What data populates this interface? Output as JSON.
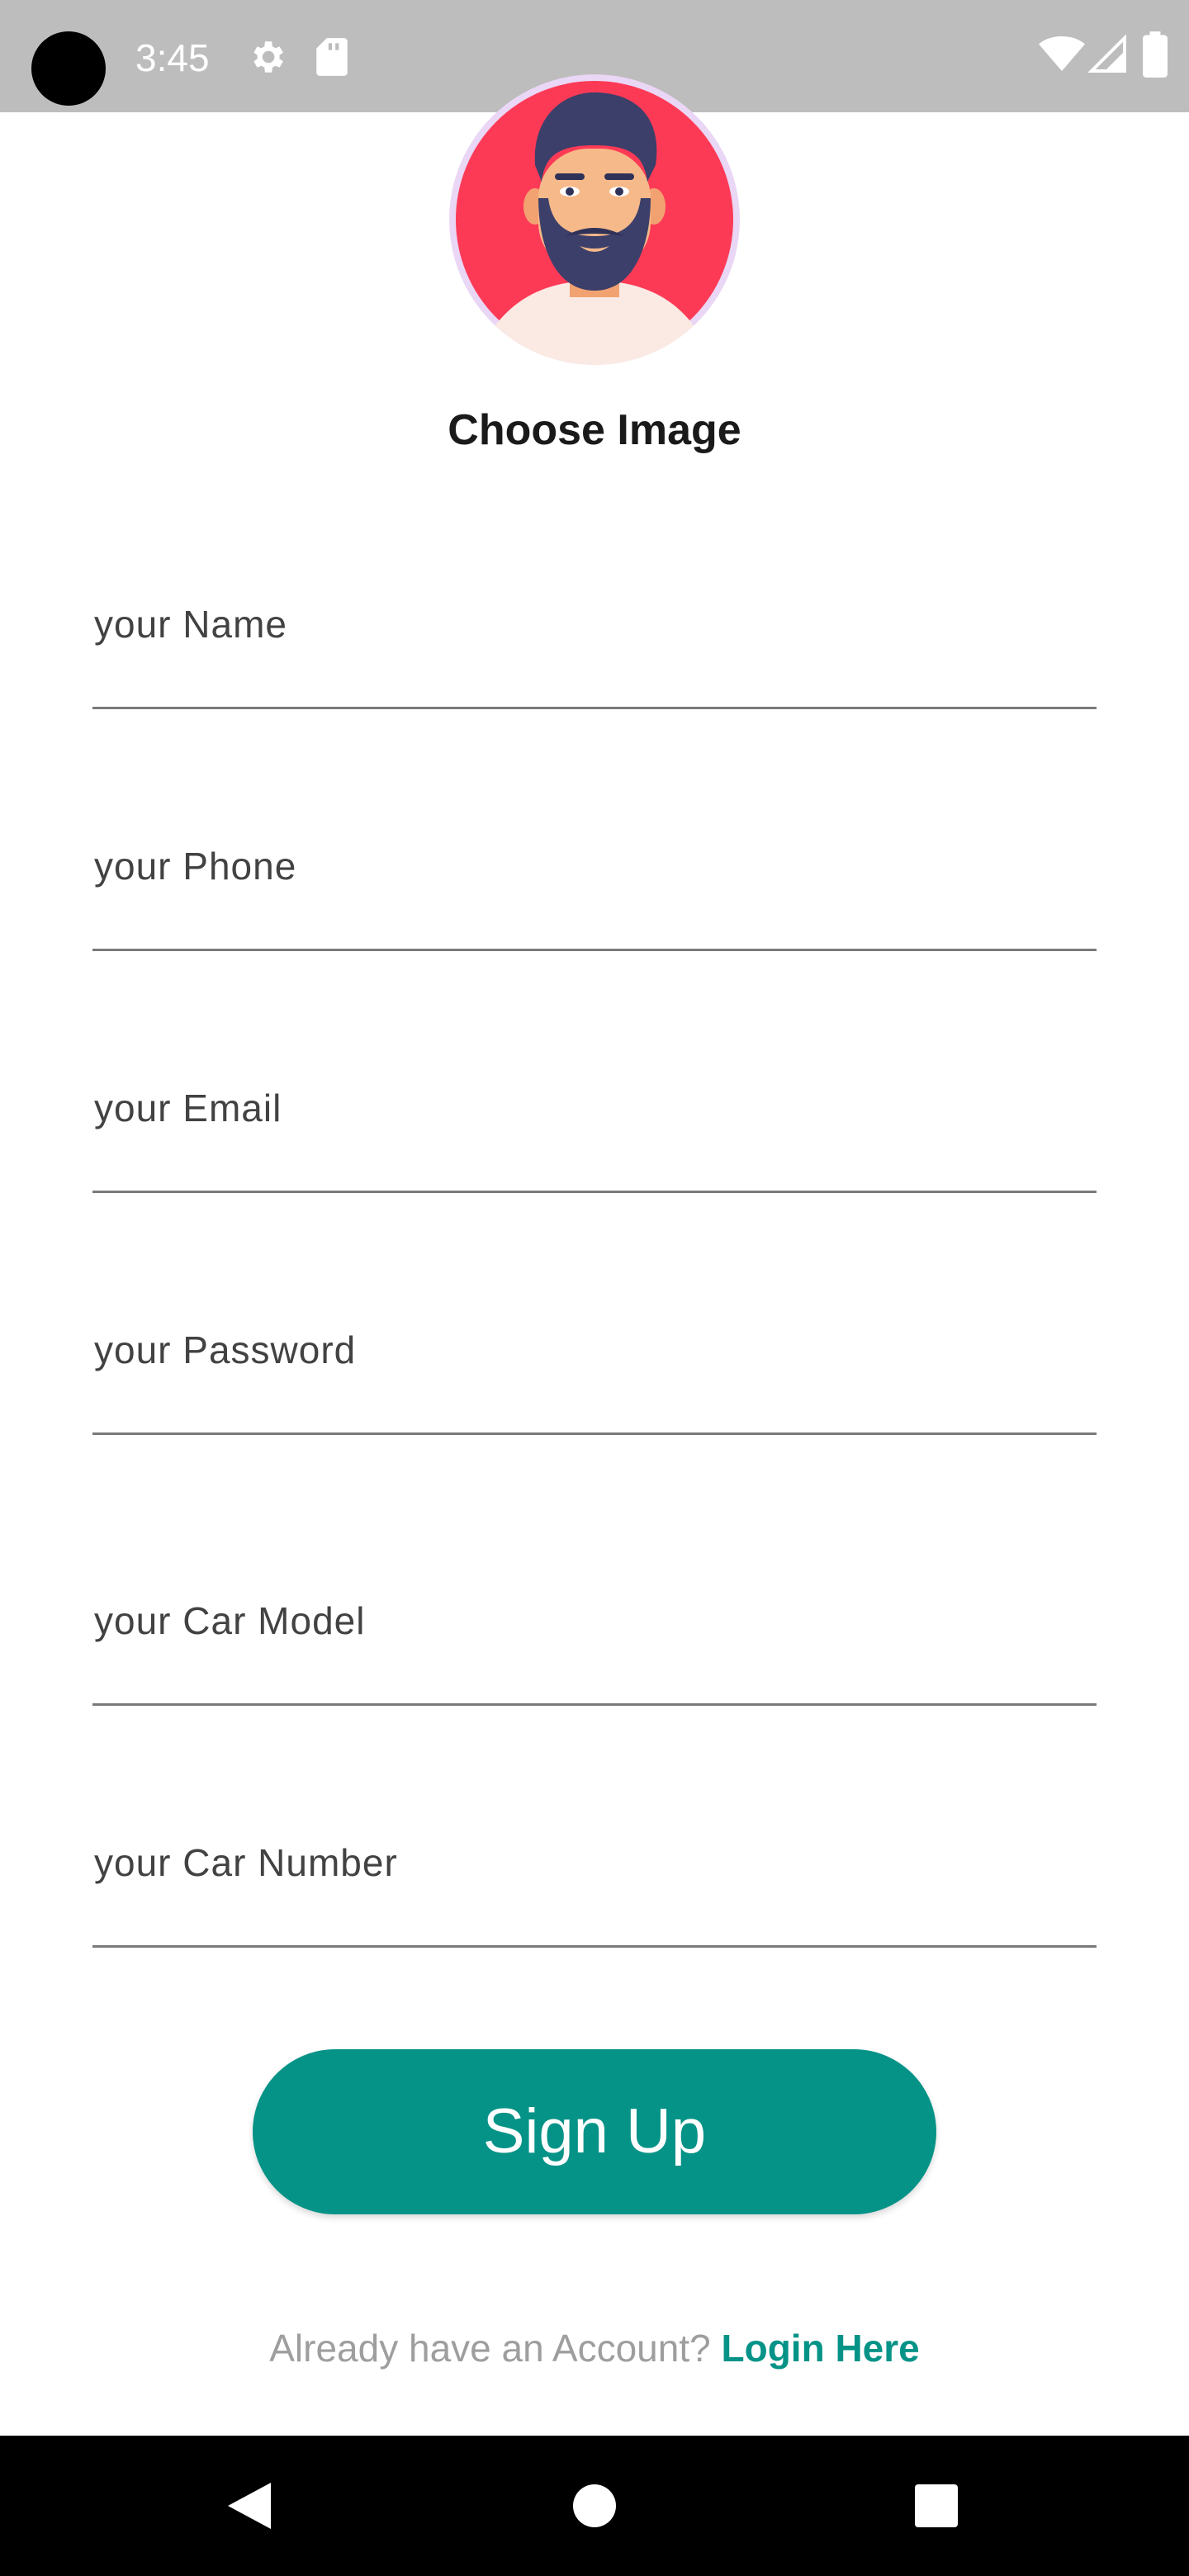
{
  "status_bar": {
    "time": "3:45",
    "icons": [
      "camera-cutout",
      "gear-icon",
      "sd-card-icon",
      "wifi-icon",
      "signal-icon",
      "battery-icon"
    ],
    "background": "#bdbdbd"
  },
  "profile": {
    "avatar_icon": "bearded-man-avatar",
    "choose_image_label": "Choose Image"
  },
  "form": {
    "fields": [
      {
        "label": "your Name"
      },
      {
        "label": "your Phone"
      },
      {
        "label": "your Email"
      },
      {
        "label": "your Password"
      },
      {
        "label": "your Car Model"
      },
      {
        "label": "your Car Number"
      }
    ]
  },
  "actions": {
    "signup_label": "Sign Up",
    "login_prompt": "Already have an Account? ",
    "login_link": "Login Here"
  },
  "colors": {
    "accent": "#069387",
    "avatar_background": "#fd3a56",
    "hint_text": "#424242",
    "muted_text": "#9e9e9e"
  },
  "nav_bar": {
    "icons": [
      "back-icon",
      "home-icon",
      "recents-icon"
    ]
  }
}
